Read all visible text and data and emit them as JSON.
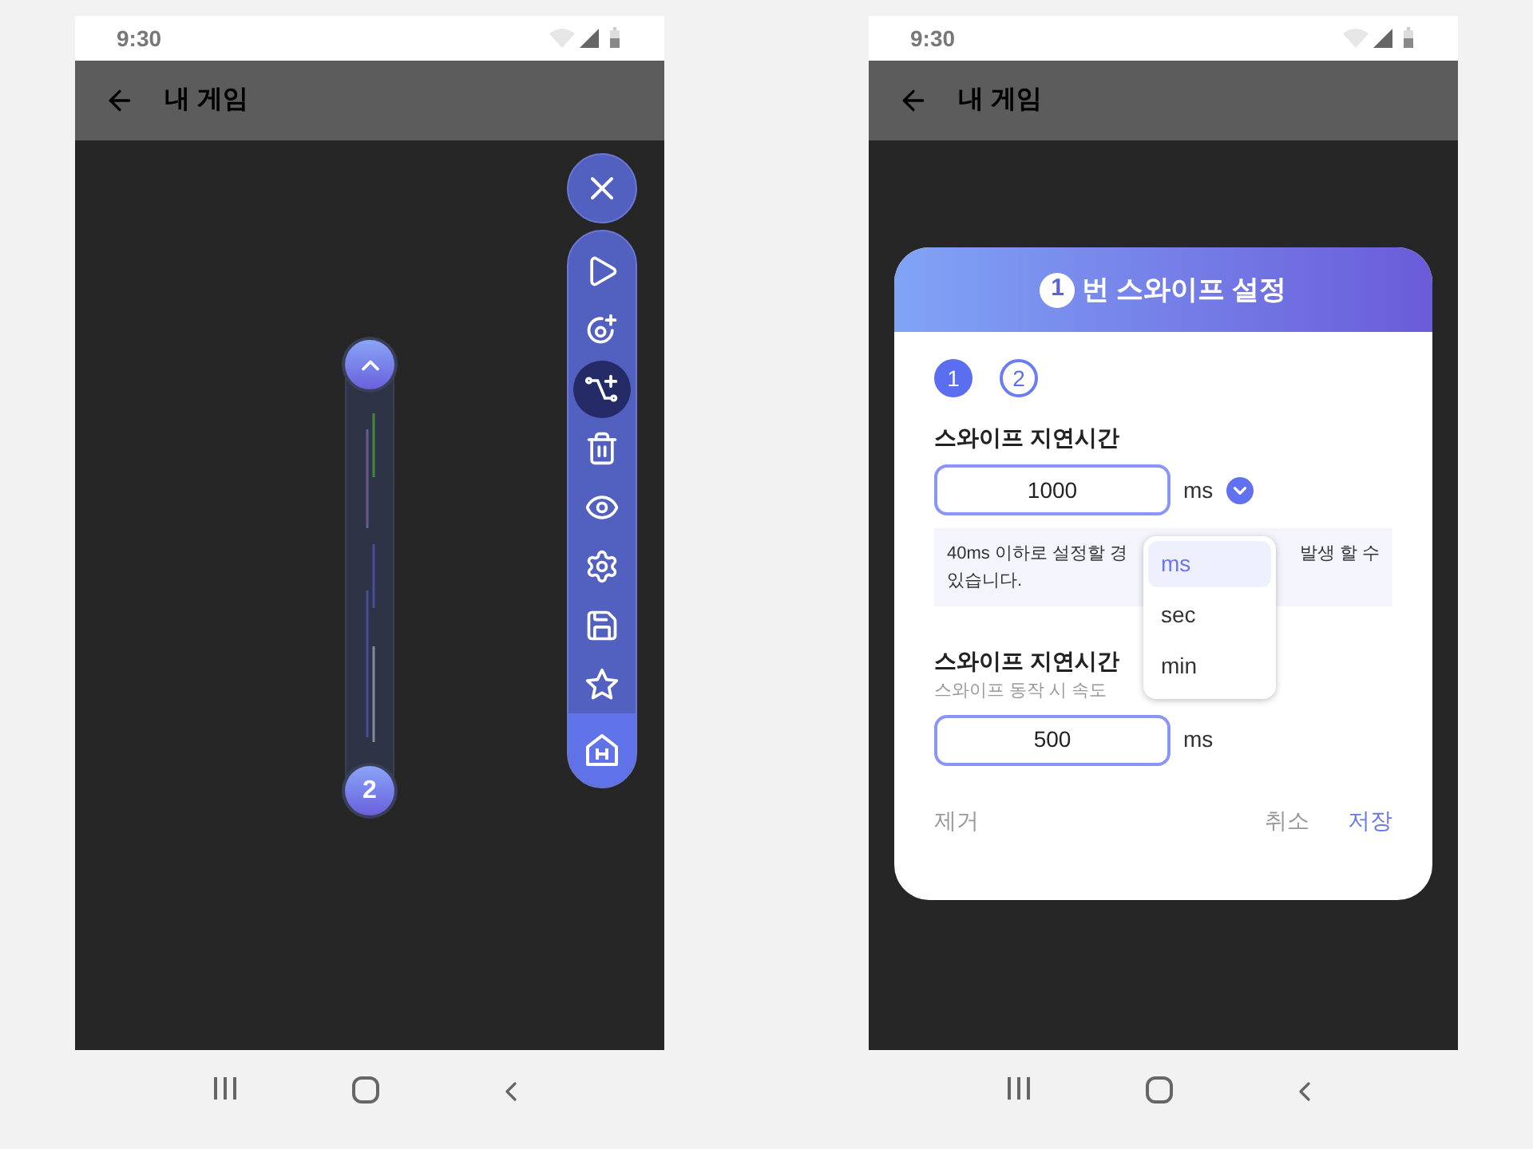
{
  "editor_screen": {
    "status_bar": {
      "time": "9:30"
    },
    "app_bar": {
      "title": "내 게임"
    },
    "swipe_track": {
      "end_label": "2"
    },
    "tools": [
      {
        "kind": "play",
        "selected": false,
        "highlighted": false
      },
      {
        "kind": "add-target",
        "selected": false,
        "highlighted": false
      },
      {
        "kind": "add-route",
        "selected": true,
        "highlighted": false
      },
      {
        "kind": "delete",
        "selected": false,
        "highlighted": false
      },
      {
        "kind": "view",
        "selected": false,
        "highlighted": false
      },
      {
        "kind": "settings",
        "selected": false,
        "highlighted": false
      },
      {
        "kind": "save",
        "selected": false,
        "highlighted": false
      },
      {
        "kind": "favorite",
        "selected": false,
        "highlighted": false
      },
      {
        "kind": "home",
        "selected": false,
        "highlighted": true
      }
    ]
  },
  "settings_screen": {
    "status_bar": {
      "time": "9:30"
    },
    "app_bar": {
      "title": "내 게임"
    },
    "dialog": {
      "title_number": "1",
      "title": "번 스와이프 설정",
      "steps": [
        {
          "label": "1",
          "selected": true
        },
        {
          "label": "2",
          "selected": false
        }
      ],
      "delay": {
        "label": "스와이프 지연시간",
        "value": "1000",
        "unit": "ms",
        "notice": [
          "40ms 이하로 설정할 경",
          "발생 할 수",
          "있습니다."
        ]
      },
      "unit_menu": [
        {
          "label": "ms",
          "selected": true
        },
        {
          "label": "sec",
          "selected": false
        },
        {
          "label": "min",
          "selected": false
        }
      ],
      "speed": {
        "label": "스와이프 지연시간",
        "hint": "스와이프 동작 시 속도",
        "value": "500",
        "unit": "ms"
      },
      "remove_button": "제거",
      "cancel_button": "취소",
      "save_button": "저장"
    }
  }
}
